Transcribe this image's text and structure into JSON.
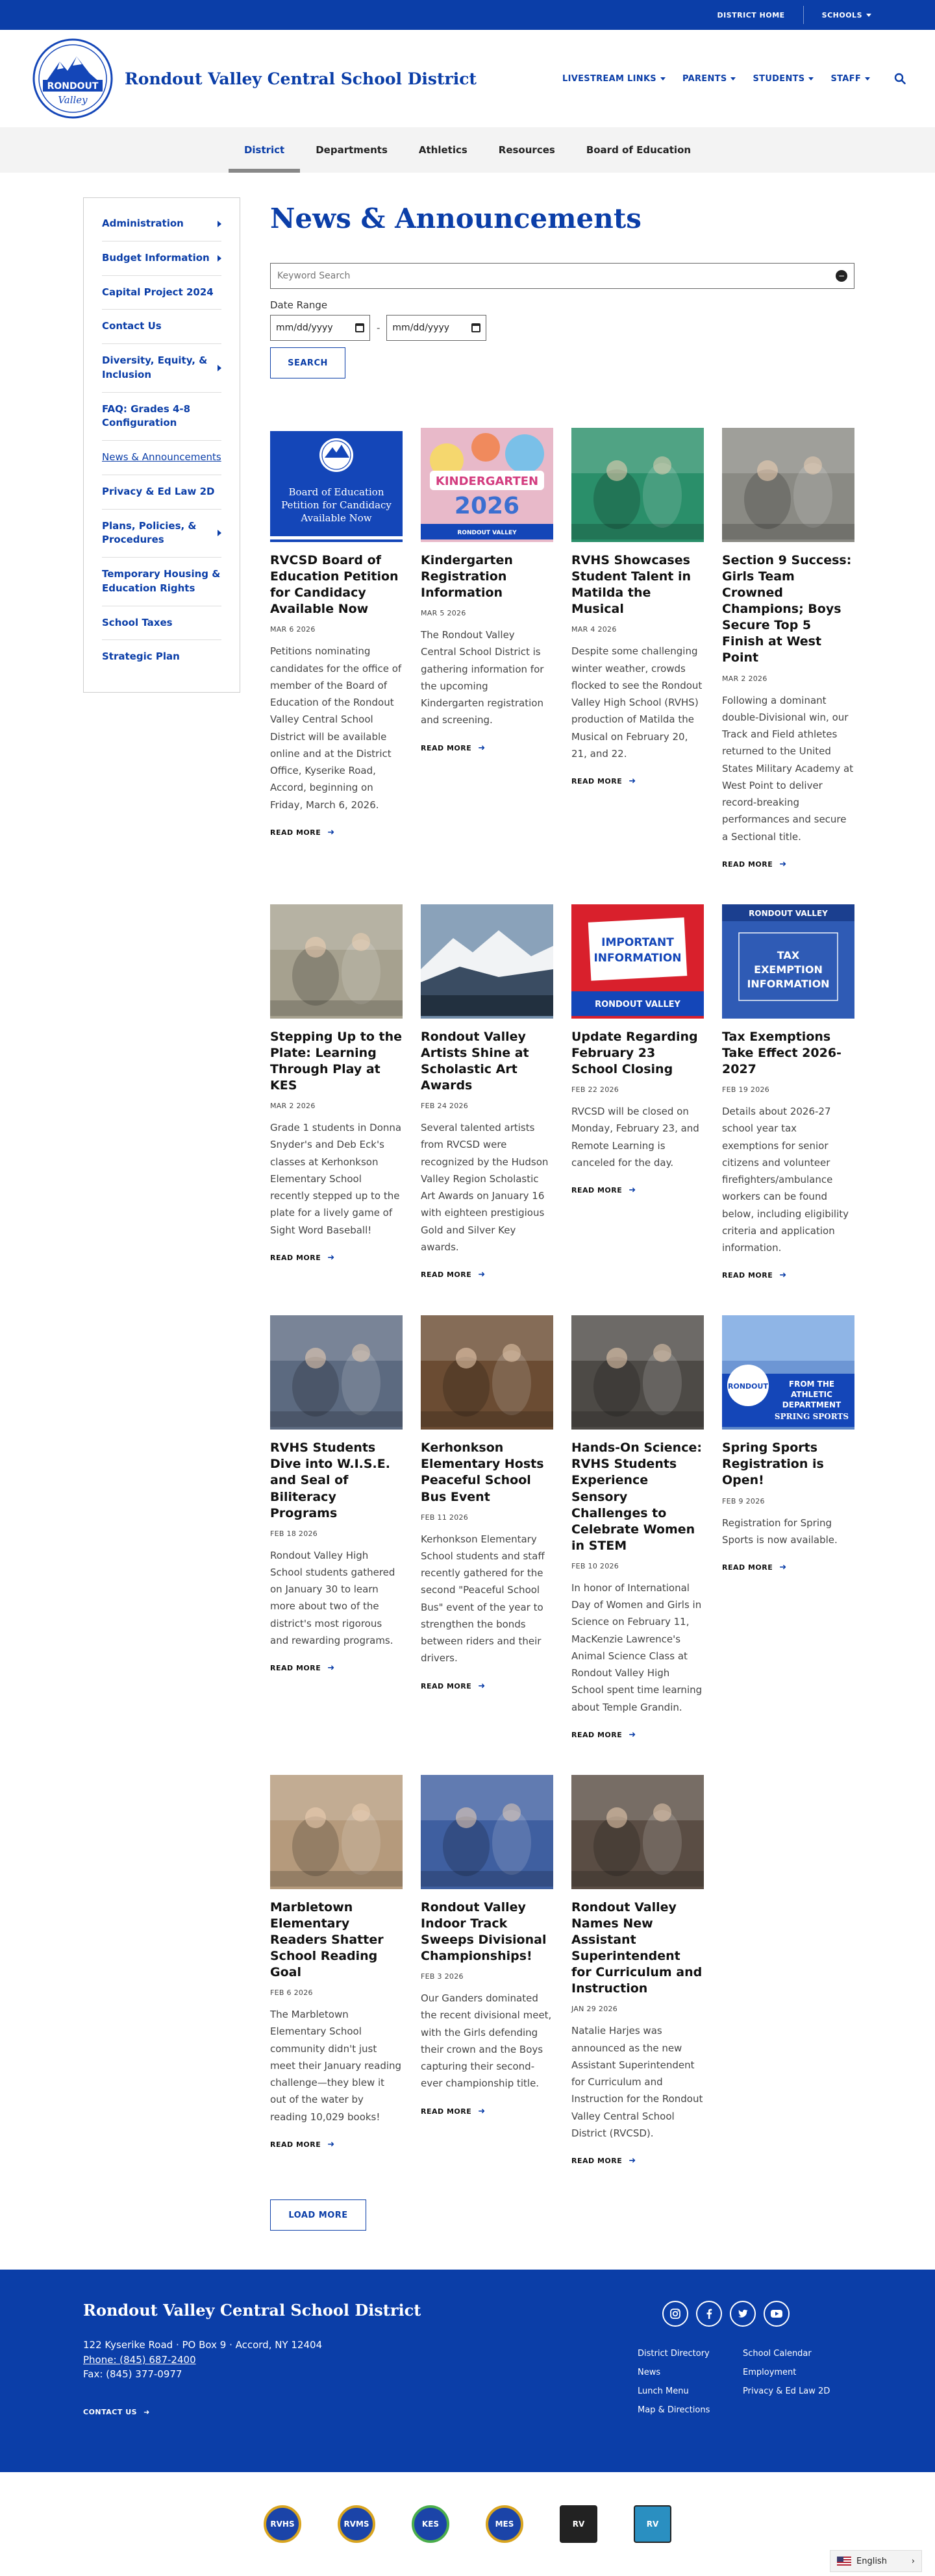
{
  "utility": {
    "district_home": "DISTRICT HOME",
    "schools": "SCHOOLS"
  },
  "header": {
    "title": "Rondout Valley Central School District",
    "logo_text_top": "RONDOUT",
    "logo_text_bottom": "Valley",
    "nav": [
      "LIVESTREAM LINKS",
      "PARENTS",
      "STUDENTS",
      "STAFF"
    ]
  },
  "subnav": [
    "District",
    "Departments",
    "Athletics",
    "Resources",
    "Board of Education"
  ],
  "sidebar": [
    {
      "label": "Administration",
      "caret": true
    },
    {
      "label": "Budget Information",
      "caret": true
    },
    {
      "label": "Capital Project 2024",
      "caret": false
    },
    {
      "label": "Contact Us",
      "caret": false
    },
    {
      "label": "Diversity, Equity, & Inclusion",
      "caret": true
    },
    {
      "label": "FAQ: Grades 4-8 Configuration",
      "caret": false
    },
    {
      "label": "News & Announcements",
      "caret": false,
      "current": true
    },
    {
      "label": "Privacy & Ed Law 2D",
      "caret": false
    },
    {
      "label": "Plans, Policies, & Procedures",
      "caret": true
    },
    {
      "label": "Temporary Housing & Education Rights",
      "caret": false
    },
    {
      "label": "School Taxes",
      "caret": false
    },
    {
      "label": "Strategic Plan",
      "caret": false
    }
  ],
  "main": {
    "title": "News & Announcements",
    "search_placeholder": "Keyword Search",
    "date_range_label": "Date Range",
    "date_placeholder": "mm/dd/yyyy",
    "date_separator": "-",
    "search_button": "SEARCH",
    "read_more": "READ MORE",
    "load_more": "LOAD MORE"
  },
  "articles": [
    {
      "title": "RVCSD Board of Education Petition for Candidacy Available Now",
      "date": "MAR 6 2026",
      "excerpt": "Petitions nominating candidates for the office of member of the Board of Education of the Rondout Valley Central School District will be available online and at the District Office, Kyserike Road, Accord, beginning on Friday, March 6, 2026.",
      "img": "petition",
      "img_text": "Board of Education Petition for Candidacy Available Now",
      "img_bg": "#1446b8"
    },
    {
      "title": "Kindergarten Registration Information",
      "date": "MAR 5 2026",
      "excerpt": "The Rondout Valley Central School District is gathering information for the upcoming Kindergarten registration and screening.",
      "img": "kindergarten",
      "img_text": "KINDERGARTEN",
      "img_year": "2026",
      "img_footer": "RONDOUT VALLEY",
      "img_bg": "#e8b9c9"
    },
    {
      "title": "RVHS Showcases Student Talent in Matilda the Musical",
      "date": "MAR 4 2026",
      "excerpt": "Despite some challenging winter weather, crowds flocked to see the Rondout Valley High School (RVHS) production of Matilda the Musical on February 20, 21, and 22.",
      "img": "photo",
      "img_bg": "#2a8f6a"
    },
    {
      "title": "Section 9 Success: Girls Team Crowned Champions; Boys Secure Top 5 Finish at West Point",
      "date": "MAR 2 2026",
      "excerpt": "Following a dominant double-Divisional win, our Track and Field athletes returned to the United States Military Academy at West Point to deliver record-breaking performances and secure a Sectional title.",
      "img": "photo",
      "img_bg": "#8a8a84"
    },
    {
      "title": "Stepping Up to the Plate: Learning Through Play at KES",
      "date": "MAR 2 2026",
      "excerpt": "Grade 1 students in Donna Snyder's and Deb Eck's classes at Kerhonkson Elementary School recently stepped up to the plate for a lively game of Sight Word Baseball!",
      "img": "photo",
      "img_bg": "#a6a18f"
    },
    {
      "title": "Rondout Valley Artists Shine at Scholastic Art Awards",
      "date": "FEB 24 2026",
      "excerpt": "Several talented artists from RVCSD were recognized by the Hudson Valley Region Scholastic Art Awards on January 16 with eighteen prestigious Gold and Silver Key awards.",
      "img": "mountain",
      "img_bg": "#6f8aa6"
    },
    {
      "title": "Update Regarding February 23 School Closing",
      "date": "FEB 22 2026",
      "excerpt": "RVCSD will be closed on Monday, February 23, and Remote Learning is canceled for the day.",
      "img": "important",
      "img_text": "IMPORTANT INFORMATION",
      "img_footer": "RONDOUT VALLEY",
      "img_bg": "#d9202c"
    },
    {
      "title": "Tax Exemptions Take Effect 2026-2027",
      "date": "FEB 19 2026",
      "excerpt": "Details about 2026-27 school year tax exemptions for senior citizens and volunteer firefighters/ambulance workers can be found below, including eligibility criteria and application information.",
      "img": "tax",
      "img_text": "TAX EXEMPTION INFORMATION",
      "img_header": "RONDOUT VALLEY",
      "img_bg": "#2f5bb5"
    },
    {
      "title": "RVHS Students Dive into W.I.S.E. and Seal of Biliteracy Programs",
      "date": "FEB 18 2026",
      "excerpt": "Rondout Valley High School students gathered on January 30 to learn more about two of the district's most rigorous and rewarding programs.",
      "img": "photo",
      "img_bg": "#5c6a80"
    },
    {
      "title": "Kerhonkson Elementary Hosts Peaceful School Bus Event",
      "date": "FEB 11 2026",
      "excerpt": "Kerhonkson Elementary School students and staff recently gathered for the second \"Peaceful School Bus\" event of the year to strengthen the bonds between riders and their drivers.",
      "img": "photo",
      "img_bg": "#6b4c33"
    },
    {
      "title": "Hands-On Science: RVHS Students Experience Sensory Challenges to Celebrate Women in STEM",
      "date": "FEB 10 2026",
      "excerpt": "In honor of International Day of Women and Girls in Science on February 11, MacKenzie Lawrence's Animal Science Class at Rondout Valley High School spent time learning about Temple Grandin.",
      "img": "photo",
      "img_bg": "#4d4a46"
    },
    {
      "title": "Spring Sports Registration is Open!",
      "date": "FEB 9 2026",
      "excerpt": "Registration for Spring Sports is now available.",
      "img": "sports",
      "img_text": "FROM THE ATHLETIC DEPARTMENT",
      "img_sub": "SPRING SPORTS",
      "img_badge": "RONDOUT",
      "img_bg": "#5b86c8"
    },
    {
      "title": "Marbletown Elementary Readers Shatter School Reading Goal",
      "date": "FEB 6 2026",
      "excerpt": "The Marbletown Elementary School community didn't just meet their January reading challenge—they blew it out of the water by reading 10,029 books!",
      "img": "photo",
      "img_bg": "#b59a7c"
    },
    {
      "title": "Rondout Valley Indoor Track Sweeps Divisional Championships!",
      "date": "FEB 3 2026",
      "excerpt": "Our Ganders dominated the recent divisional meet, with the Girls defending their crown and the Boys capturing their second-ever championship title.",
      "img": "photo",
      "img_bg": "#3f5fa0"
    },
    {
      "title": "Rondout Valley Names New Assistant Superintendent for Curriculum and Instruction",
      "date": "JAN 29 2026",
      "excerpt": "Natalie Harjes was announced as the new Assistant Superintendent for Curriculum and Instruction for the Rondout Valley Central School District (RVCSD).",
      "img": "photo",
      "img_bg": "#5a4d44"
    }
  ],
  "footer": {
    "name": "Rondout Valley Central School District",
    "address": "122 Kyserike Road · PO Box 9 · Accord, NY  12404",
    "phone": "Phone: (845) 687-2400",
    "fax": "Fax: (845) 377-0977",
    "contact": "CONTACT US",
    "socials": [
      "instagram-icon",
      "facebook-icon",
      "twitter-icon",
      "youtube-icon"
    ],
    "links": [
      "District Directory",
      "School Calendar",
      "News",
      "Employment",
      "Lunch Menu",
      "Privacy & Ed Law 2D",
      "Map & Directions"
    ]
  },
  "partners": [
    {
      "label": "RVHS",
      "color": "#1b44a8",
      "ring": "#d9a520"
    },
    {
      "label": "RVMS",
      "color": "#1b44a8",
      "ring": "#d9a520"
    },
    {
      "label": "KES",
      "color": "#1b44a8",
      "ring": "#4cae4c"
    },
    {
      "label": "MES",
      "color": "#1b44a8",
      "ring": "#d9a520"
    },
    {
      "label": "RV",
      "color": "#222222",
      "ring": "#ffffff"
    },
    {
      "label": "RV",
      "color": "#2a8fc1",
      "ring": "#ffffff"
    }
  ],
  "language": "English"
}
